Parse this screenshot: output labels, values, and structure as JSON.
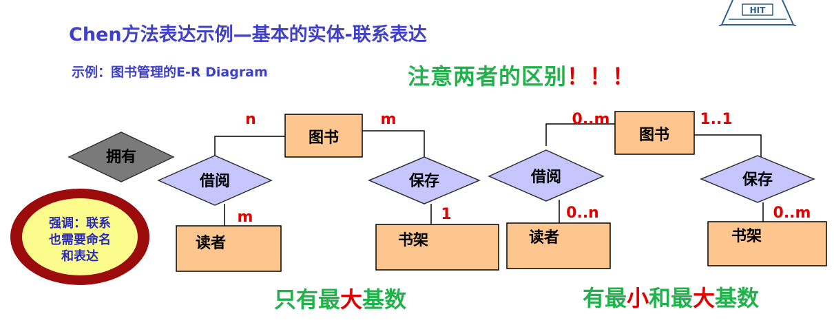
{
  "title": "Chen方法表达示例—基本的实体-联系表达",
  "subtitle": "示例：图书管理的E-R Diagram",
  "note": {
    "text": "注意两者的区别",
    "exclaim": "！！！"
  },
  "logo": {
    "text": "HIT",
    "icon": "hit-logo-icon"
  },
  "callout": {
    "lines": [
      "强调：联系",
      "也需要命名",
      "和表达"
    ]
  },
  "legend_shape": {
    "label": "拥有"
  },
  "left_diagram": {
    "entities": {
      "book": "图书",
      "reader": "读者",
      "shelf": "书架"
    },
    "relations": {
      "borrow": "借阅",
      "store": "保存"
    },
    "cardinalities": {
      "borrow_book": "n",
      "store_book": "m",
      "borrow_reader": "m",
      "store_shelf": "1"
    },
    "caption": {
      "part1": "只有最",
      "highlight": "大",
      "part2": "基数"
    }
  },
  "right_diagram": {
    "entities": {
      "book": "图书",
      "reader": "读者",
      "shelf": "书架"
    },
    "relations": {
      "borrow": "借阅",
      "store": "保存"
    },
    "cardinalities": {
      "borrow_book": "0..m",
      "store_book": "1..1",
      "borrow_reader": "0..n",
      "store_shelf": "0..m"
    },
    "caption": {
      "part1": "有最",
      "highlight1": "小",
      "part2": "和最",
      "highlight2": "大",
      "part3": "基数"
    }
  },
  "colors": {
    "entity_fill": "#fcc68e",
    "relation_fill": "#c6c6fc",
    "title": "#3f3fc8",
    "green": "#22b24c",
    "red": "#e00000",
    "callout_ring": "#9c0b0b",
    "callout_fill": "#fcfc8c"
  }
}
